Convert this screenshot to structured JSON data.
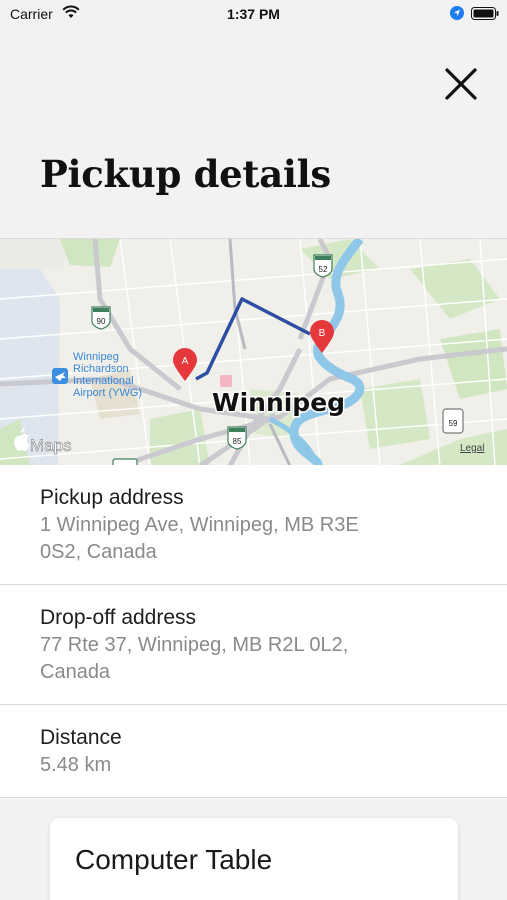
{
  "status_bar": {
    "carrier": "Carrier",
    "time": "1:37 PM"
  },
  "header": {
    "title": "Pickup details",
    "close_icon": "close-icon"
  },
  "map": {
    "city_label": "Winnipeg",
    "airport_label_lines": [
      "Winnipeg",
      "Richardson",
      "International",
      "Airport (YWG)"
    ],
    "highway_shields": [
      "90",
      "52",
      "85",
      "59"
    ],
    "brand": "Maps",
    "legal": "Legal",
    "pin_a": "A",
    "pin_b": "B",
    "route_color": "#2d4fa3",
    "pin_color": "#e5383b"
  },
  "details": {
    "pickup_label": "Pickup address",
    "pickup_line1": "1 Winnipeg Ave, Winnipeg, MB R3E",
    "pickup_line2": "0S2, Canada",
    "dropoff_label": "Drop-off address",
    "dropoff_line1": "77 Rte 37, Winnipeg, MB R2L 0L2,",
    "dropoff_line2": "Canada",
    "distance_label": "Distance",
    "distance_value": "5.48 km"
  },
  "card": {
    "title": "Computer Table"
  }
}
